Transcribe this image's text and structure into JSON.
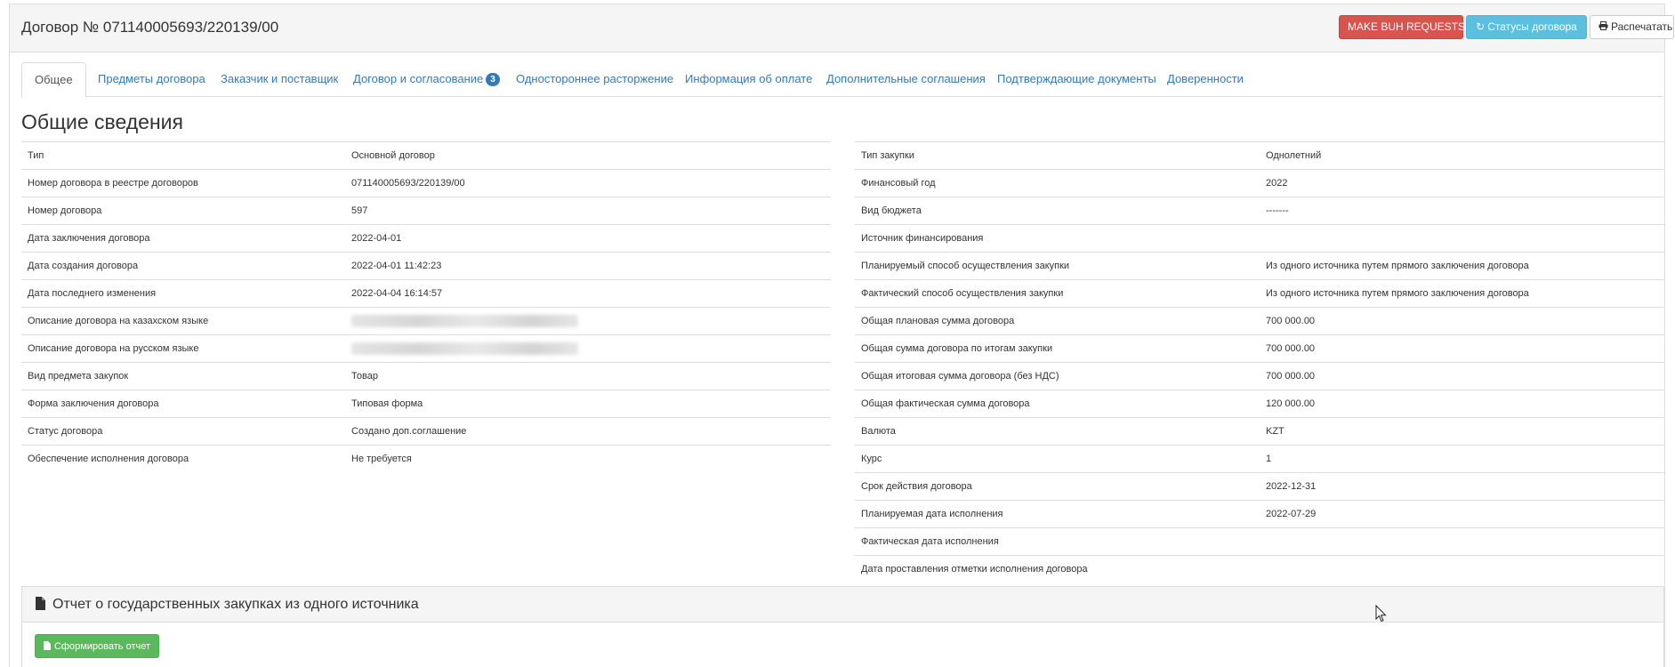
{
  "header": {
    "title": "Договор № 071140005693/220139/00",
    "buttons": {
      "buh_requests": "MAKE BUH REQUESTS",
      "statuses": "Статусы договора",
      "print": "Распечатать"
    }
  },
  "tabs": [
    {
      "label": "Общее"
    },
    {
      "label": "Предметы договора"
    },
    {
      "label": "Заказчик и поставщик"
    },
    {
      "label": "Договор и согласование",
      "badge": "3"
    },
    {
      "label": "Одностороннее расторжение"
    },
    {
      "label": "Информация об оплате"
    },
    {
      "label": "Дополнительные соглашения"
    },
    {
      "label": "Подтверждающие документы"
    },
    {
      "label": "Доверенности"
    }
  ],
  "section_title": "Общие сведения",
  "left_rows": [
    {
      "label": "Тип",
      "value": "Основной договор"
    },
    {
      "label": "Номер договора в реестре договоров",
      "value": "071140005693/220139/00"
    },
    {
      "label": "Номер договора",
      "value": "597"
    },
    {
      "label": "Дата заключения договора",
      "value": "2022-04-01"
    },
    {
      "label": "Дата создания договора",
      "value": "2022-04-01 11:42:23"
    },
    {
      "label": "Дата последнего изменения",
      "value": "2022-04-04 16:14:57"
    },
    {
      "label": "Описание договора на казахском языке",
      "value": ""
    },
    {
      "label": "Описание договора на русском языке",
      "value": ""
    },
    {
      "label": "Вид предмета закупок",
      "value": "Товар"
    },
    {
      "label": "Форма заключения договора",
      "value": "Типовая форма"
    },
    {
      "label": "Статус договора",
      "value": "Создано доп.соглашение"
    },
    {
      "label": "Обеспечение исполнения договора",
      "value": "Не требуется"
    }
  ],
  "right_rows": [
    {
      "label": "Тип закупки",
      "value": "Однолетний"
    },
    {
      "label": "Финансовый год",
      "value": "2022"
    },
    {
      "label": "Вид бюджета",
      "value": "-------"
    },
    {
      "label": "Источник финансирования",
      "value": ""
    },
    {
      "label": "Планируемый способ осуществления закупки",
      "value": "Из одного источника путем прямого заключения договора"
    },
    {
      "label": "Фактический способ осуществления закупки",
      "value": "Из одного источника путем прямого заключения договора"
    },
    {
      "label": "Общая плановая сумма договора",
      "value": "700 000.00"
    },
    {
      "label": "Общая сумма договора по итогам закупки",
      "value": "700 000.00"
    },
    {
      "label": "Общая итоговая сумма договора (без НДС)",
      "value": "700 000.00"
    },
    {
      "label": "Общая фактическая сумма договора",
      "value": "120 000.00"
    },
    {
      "label": "Валюта",
      "value": "KZT"
    },
    {
      "label": "Курс",
      "value": "1"
    },
    {
      "label": "Срок действия договора",
      "value": "2022-12-31"
    },
    {
      "label": "Планируемая дата исполнения",
      "value": "2022-07-29"
    },
    {
      "label": "Фактическая дата исполнения",
      "value": ""
    },
    {
      "label": "Дата проставления отметки исполнения договора",
      "value": ""
    }
  ],
  "report": {
    "title": "Отчет о государственных закупках из одного источника",
    "button": "Сформировать отчет"
  },
  "colors": {
    "danger": "#d9534f",
    "info": "#5bc0de",
    "success": "#5cb85c",
    "link": "#337ab7"
  }
}
